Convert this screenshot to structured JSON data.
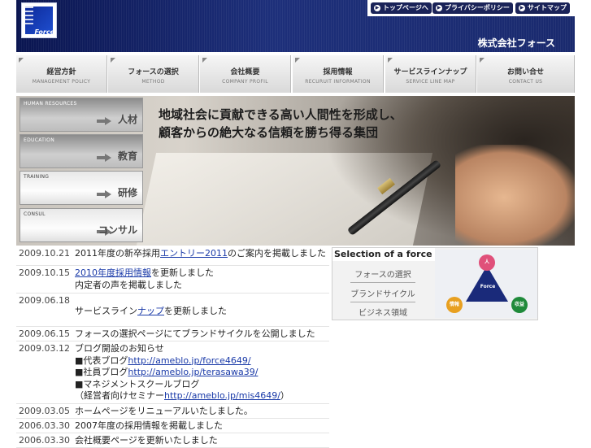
{
  "header": {
    "logo_text": "Force",
    "company": "株式会社フォース",
    "toplinks": [
      "トップページへ",
      "プライバシーポリシー",
      "サイトマップ"
    ]
  },
  "nav": [
    {
      "jp": "経営方針",
      "en": "MANAGEMENT POLICY"
    },
    {
      "jp": "フォースの選択",
      "en": "METHOD"
    },
    {
      "jp": "会社概要",
      "en": "COMPANY PROFIL"
    },
    {
      "jp": "採用情報",
      "en": "RECURUIT INFORMATION"
    },
    {
      "jp": "サービスラインナップ",
      "en": "SERVICE LINE MAP"
    },
    {
      "jp": "お問い合せ",
      "en": "CONTACT US"
    }
  ],
  "hero": {
    "slogan_line1": "地域社会に貢献できる高い人間性を形成し、",
    "slogan_line2": "顧客からの絶大なる信頼を勝ち得る集団"
  },
  "side": [
    {
      "en": "HUMAN RESOURCES",
      "jp": "人材"
    },
    {
      "en": "EDUCATION",
      "jp": "教育"
    },
    {
      "en": "TRAINING",
      "jp": "研修"
    },
    {
      "en": "CONSUL",
      "jp": "コンサル"
    }
  ],
  "news": [
    {
      "date": "2009.10.21",
      "pre": "2011年度の新卒採用",
      "link": "エントリー2011",
      "post": "のご案内を掲載しました"
    },
    {
      "date": "2009.10.15",
      "pre": "",
      "link": "2010年度採用情報",
      "post": "を更新しました",
      "line2": "内定者の声を掲載しました"
    },
    {
      "date": "2009.06.18",
      "pre": "",
      "link": "",
      "post": "",
      "line2_pre": "サービスライン",
      "line2_link": "ナップ",
      "line2_post": "を更新しました"
    },
    {
      "date": "2009.06.15",
      "text": "フォースの選択ページにてブランドサイクルを公開しました"
    },
    {
      "date": "2009.03.12",
      "text": "ブログ開設のお知らせ",
      "lines": [
        {
          "pre": "■代表ブログ",
          "link": "http://ameblo.jp/force4649/"
        },
        {
          "pre": "■社員ブログ",
          "link": "http://ameblo.jp/terasawa39/"
        },
        {
          "pre": "■マネジメントスクールブログ",
          "link": ""
        },
        {
          "pre": "（経営者向けセミナー",
          "link": "http://ameblo.jp/mis4649/",
          "post": "）"
        }
      ]
    },
    {
      "date": "2009.03.05",
      "text": "ホームページをリニューアルいたしました。"
    },
    {
      "date": "2006.03.30",
      "text": "2007年度の採用情報を掲載しました"
    },
    {
      "date": "2006.03.30",
      "text": "会社概要ページを更新いたしました"
    }
  ],
  "selection": {
    "title": "Selection of a force",
    "items": [
      "フォースの選択",
      "ブランドサイクル",
      "ビジネス領域"
    ],
    "diagram_labels": {
      "top": "人",
      "center": "Force",
      "left": "情報",
      "right": "収益"
    }
  },
  "colors": {
    "header": "#1a2a6e",
    "link": "#1a3aa8",
    "diagram_top": "#e0507a",
    "diagram_left": "#e8a020",
    "diagram_right": "#1f8a3a"
  }
}
